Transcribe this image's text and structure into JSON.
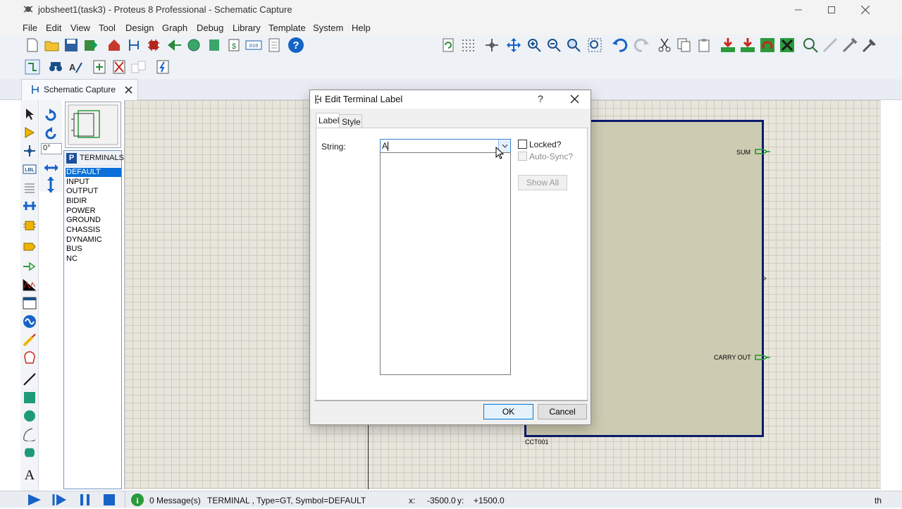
{
  "window": {
    "title": "jobsheet1(task3) - Proteus 8 Professional - Schematic Capture",
    "controls": [
      "minimize-icon",
      "maximize-icon",
      "close-icon"
    ]
  },
  "menu": [
    "File",
    "Edit",
    "View",
    "Tool",
    "Design",
    "Graph",
    "Debug",
    "Library",
    "Template",
    "System",
    "Help"
  ],
  "tab": {
    "label": "Schematic Capture"
  },
  "terminals_panel": {
    "header_badge": "P",
    "header": "TERMINALS",
    "angle": "0°",
    "items": [
      "DEFAULT",
      "INPUT",
      "OUTPUT",
      "BIDIR",
      "POWER",
      "GROUND",
      "CHASSIS",
      "DYNAMIC",
      "BUS",
      "NC"
    ],
    "selected": "DEFAULT"
  },
  "schematic": {
    "pins": {
      "sum": "SUM",
      "carry_out": "CARRY OUT"
    },
    "component_ref": "CCT001"
  },
  "dialog": {
    "title": "Edit Terminal Label",
    "help": "?",
    "tabs": [
      "Label",
      "Style"
    ],
    "string_label": "String:",
    "string_value": "A",
    "locked_label": "Locked?",
    "autosync_label": "Auto-Sync?",
    "show_all": "Show All",
    "ok": "OK",
    "cancel": "Cancel"
  },
  "status": {
    "messages": "0 Message(s)",
    "info": "TERMINAL , Type=GT, Symbol=DEFAULT",
    "x_label": "x:",
    "x_value": "-3500.0",
    "y_label": "y:",
    "y_value": "+1500.0",
    "trailing": "th"
  },
  "colors": {
    "accent": "#0078d7",
    "sheet_border": "#0b1b6e",
    "sheet_fill": "#cdcbb1",
    "terminal_green": "#1e9a2a",
    "selection": "#0a6fd8"
  }
}
